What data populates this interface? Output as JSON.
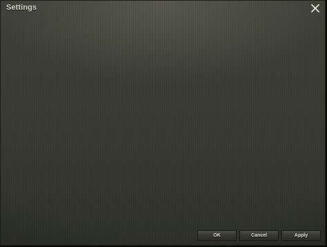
{
  "window": {
    "title": "Settings"
  },
  "buttons": {
    "ok": "OK",
    "cancel": "Cancel",
    "apply": "Apply"
  },
  "icons": {
    "close": "close-icon"
  },
  "colors": {
    "background": "#3a3c34",
    "title_text": "#d9d8cc",
    "button_text": "#e2e1d4"
  }
}
